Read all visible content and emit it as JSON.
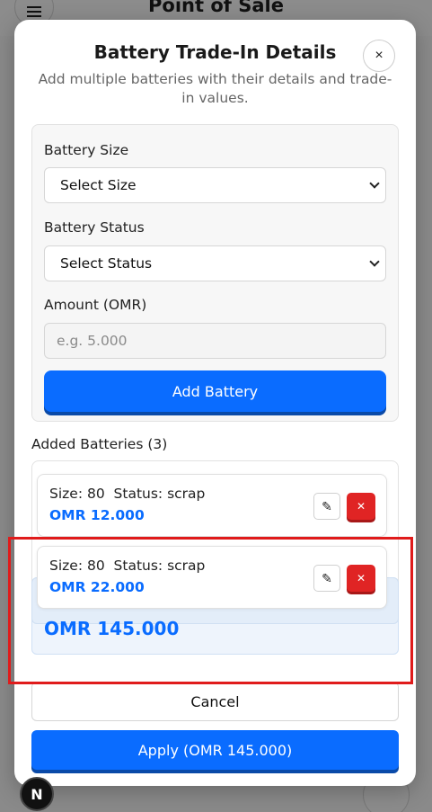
{
  "app": {
    "title": "Point of Sale"
  },
  "modal": {
    "title": "Battery Trade-In Details",
    "subtitle": "Add multiple batteries with their details and trade-in values.",
    "close_symbol": "×"
  },
  "form": {
    "battery_size": {
      "label": "Battery Size",
      "selected": "Select Size"
    },
    "battery_status": {
      "label": "Battery Status",
      "selected": "Select Status"
    },
    "amount": {
      "label": "Amount (OMR)",
      "placeholder": "e.g. 5.000",
      "value": ""
    },
    "add_button": "Add Battery"
  },
  "added": {
    "heading": "Added Batteries (3)",
    "items": [
      {
        "details": "Size: 80  Status: scrap",
        "amount": "OMR 12.000"
      },
      {
        "details": "Size: 80  Status: scrap",
        "amount": "OMR 22.000"
      }
    ],
    "total": "OMR 145.000"
  },
  "actions": {
    "cancel": "Cancel",
    "apply": "Apply (OMR 145.000)"
  },
  "icons": {
    "edit": "pencil-icon",
    "delete": "close-icon",
    "menu": "menu-icon",
    "notifications": "bell-icon",
    "dev": "N"
  },
  "colors": {
    "accent": "#0a6cff",
    "danger": "#e02424",
    "highlight": "#e01b1b"
  }
}
